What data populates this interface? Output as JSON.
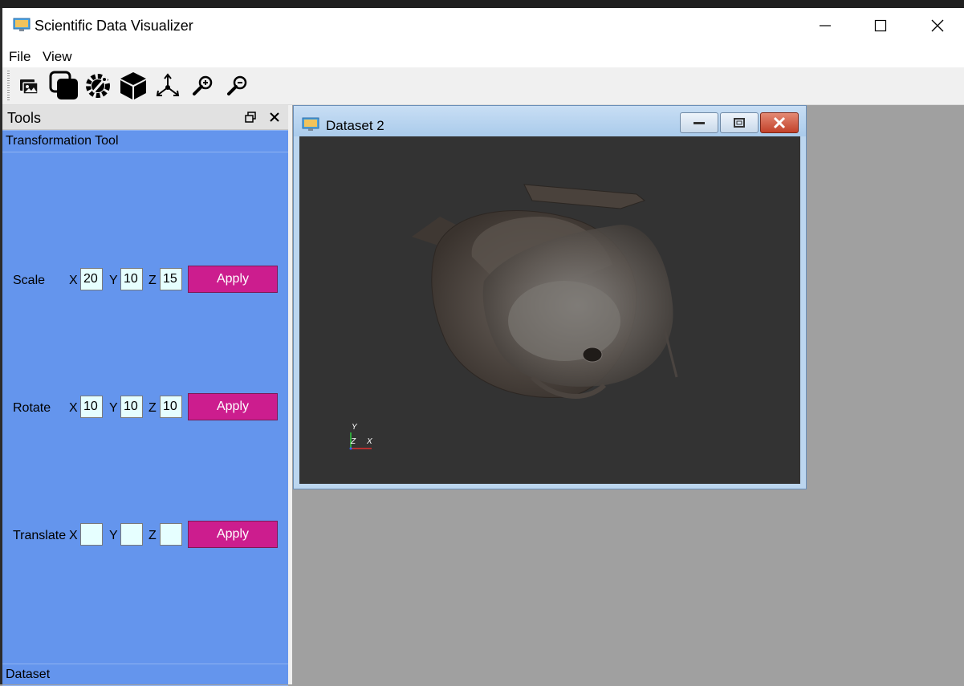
{
  "app": {
    "title": "Scientific Data Visualizer"
  },
  "menu": {
    "file": "File",
    "view": "View"
  },
  "dock": {
    "title": "Tools",
    "section": "Transformation Tool",
    "footer": "Dataset",
    "rows": {
      "scale": {
        "label": "Scale",
        "x": "20",
        "y": "10",
        "z": "15",
        "apply": "Apply"
      },
      "rotate": {
        "label": "Rotate",
        "x": "10",
        "y": "10",
        "z": "10",
        "apply": "Apply"
      },
      "translate": {
        "label": "Translate",
        "x": "",
        "y": "",
        "z": "",
        "apply": "Apply"
      }
    },
    "axis_x": "X",
    "axis_y": "Y",
    "axis_z": "Z"
  },
  "subwindow": {
    "title": "Dataset 2"
  },
  "orientation_axes": {
    "y": "Y",
    "z": "Z",
    "x": "X"
  },
  "colors": {
    "dock_bg": "#6495ed",
    "apply_bg": "#cc1d8e",
    "field_bg": "#e6ffff",
    "viewport_bg": "#333333"
  }
}
